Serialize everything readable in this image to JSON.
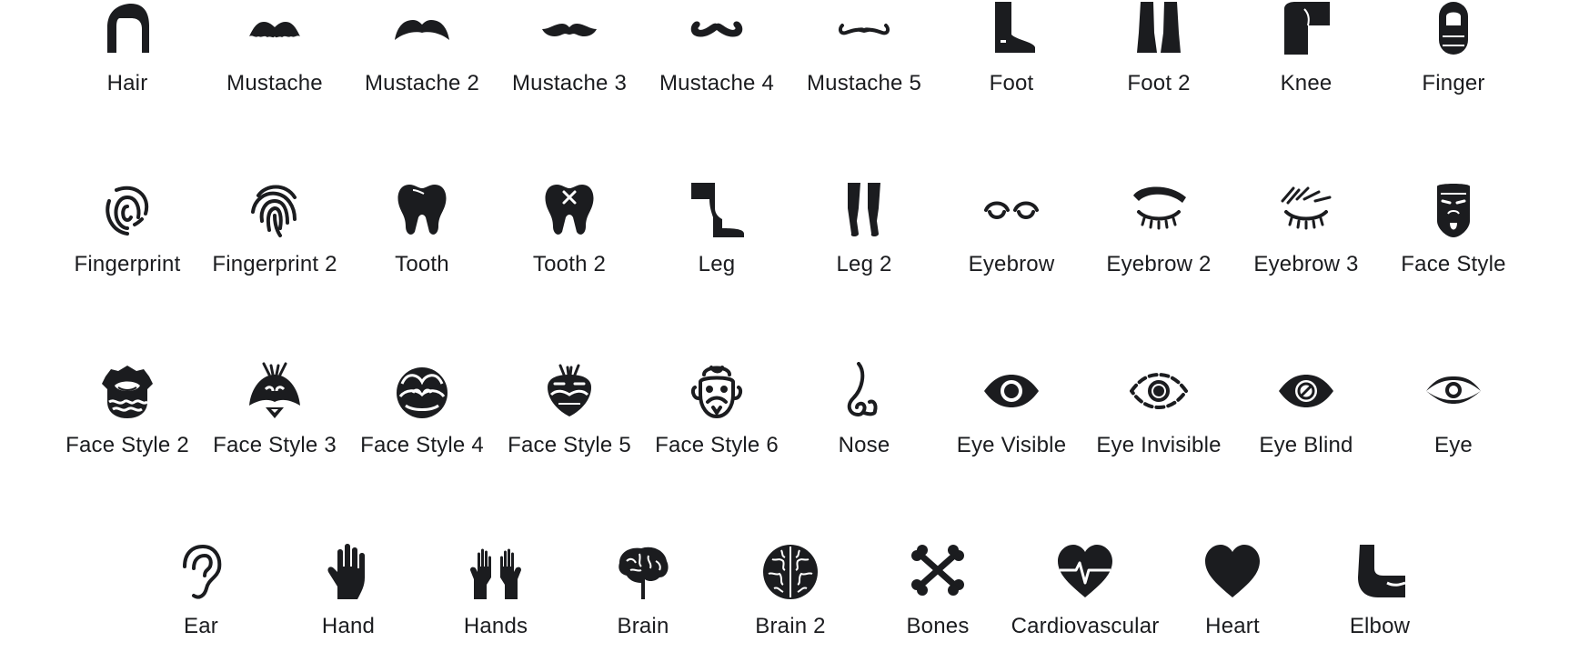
{
  "colors": {
    "icon": "#1b1c1f",
    "label": "#1b1c1f",
    "background": "#ffffff"
  },
  "rows": [
    {
      "items": [
        {
          "icon": "hair-icon",
          "label": "Hair"
        },
        {
          "icon": "mustache-icon",
          "label": "Mustache"
        },
        {
          "icon": "mustache-2-icon",
          "label": "Mustache 2"
        },
        {
          "icon": "mustache-3-icon",
          "label": "Mustache 3"
        },
        {
          "icon": "mustache-4-icon",
          "label": "Mustache 4"
        },
        {
          "icon": "mustache-5-icon",
          "label": "Mustache 5"
        },
        {
          "icon": "foot-icon",
          "label": "Foot"
        },
        {
          "icon": "foot-2-icon",
          "label": "Foot 2"
        },
        {
          "icon": "knee-icon",
          "label": "Knee"
        },
        {
          "icon": "finger-icon",
          "label": "Finger"
        }
      ]
    },
    {
      "items": [
        {
          "icon": "fingerprint-icon",
          "label": "Fingerprint"
        },
        {
          "icon": "fingerprint-2-icon",
          "label": "Fingerprint 2"
        },
        {
          "icon": "tooth-icon",
          "label": "Tooth"
        },
        {
          "icon": "tooth-2-icon",
          "label": "Tooth 2"
        },
        {
          "icon": "leg-icon",
          "label": "Leg"
        },
        {
          "icon": "leg-2-icon",
          "label": "Leg 2"
        },
        {
          "icon": "eyebrow-icon",
          "label": "Eyebrow"
        },
        {
          "icon": "eyebrow-2-icon",
          "label": "Eyebrow 2"
        },
        {
          "icon": "eyebrow-3-icon",
          "label": "Eyebrow 3"
        },
        {
          "icon": "face-style-icon",
          "label": "Face Style"
        }
      ]
    },
    {
      "items": [
        {
          "icon": "face-style-2-icon",
          "label": "Face Style 2"
        },
        {
          "icon": "face-style-3-icon",
          "label": "Face Style 3"
        },
        {
          "icon": "face-style-4-icon",
          "label": "Face Style 4"
        },
        {
          "icon": "face-style-5-icon",
          "label": "Face Style 5"
        },
        {
          "icon": "face-style-6-icon",
          "label": "Face Style 6"
        },
        {
          "icon": "nose-icon",
          "label": "Nose"
        },
        {
          "icon": "eye-visible-icon",
          "label": "Eye Visible"
        },
        {
          "icon": "eye-invisible-icon",
          "label": "Eye Invisible"
        },
        {
          "icon": "eye-blind-icon",
          "label": "Eye Blind"
        },
        {
          "icon": "eye-icon",
          "label": "Eye"
        }
      ]
    },
    {
      "items": [
        {
          "icon": "ear-icon",
          "label": "Ear"
        },
        {
          "icon": "hand-icon",
          "label": "Hand"
        },
        {
          "icon": "hands-icon",
          "label": "Hands"
        },
        {
          "icon": "brain-icon",
          "label": "Brain"
        },
        {
          "icon": "brain-2-icon",
          "label": "Brain 2"
        },
        {
          "icon": "bones-icon",
          "label": "Bones"
        },
        {
          "icon": "cardiovascular-icon",
          "label": "Cardiovascular"
        },
        {
          "icon": "heart-icon",
          "label": "Heart"
        },
        {
          "icon": "elbow-icon",
          "label": "Elbow"
        }
      ]
    }
  ]
}
